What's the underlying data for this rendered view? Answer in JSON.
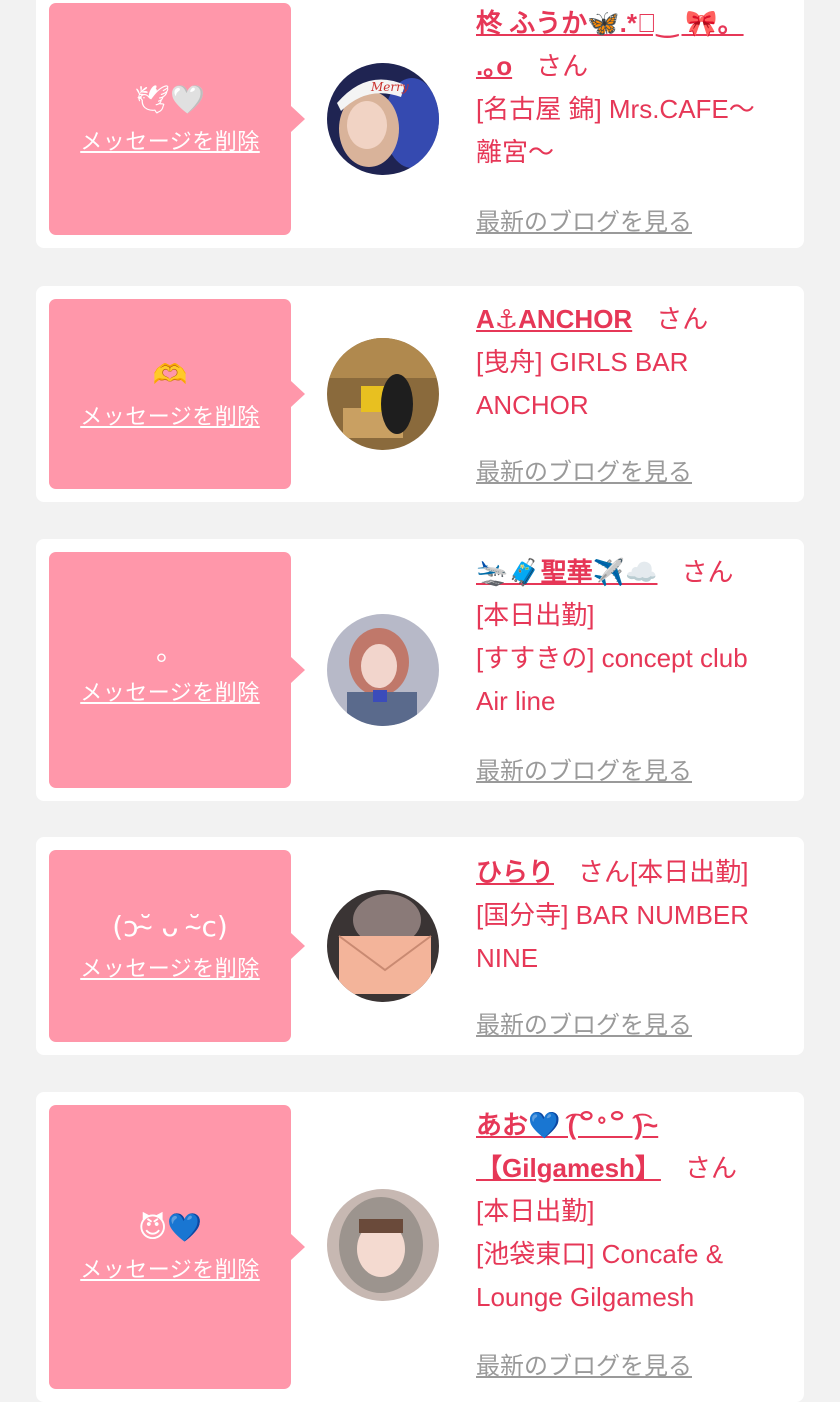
{
  "delete_label": "メッセージを削除",
  "blog_label": "最新のブログを見る",
  "honorific": "さん",
  "colors": {
    "card_bg": "#ffffff",
    "page_bg": "#f2f2f2",
    "bubble_bg": "#ff97aa",
    "accent_text": "#e63757",
    "link_gray": "#9a9a9a"
  },
  "entries": [
    {
      "message": "🕊🤍",
      "name_line1": "柊 ふうか🦋.*ﾟ‿ 🎀。",
      "name_line2": ".｡o",
      "details": [
        "[名古屋 錦] Mrs.CAFE〜",
        "離宮〜"
      ],
      "avatar_icon": "avatar-christmas-photo"
    },
    {
      "message": "🫶",
      "name_line1": "A⚓ANCHOR",
      "details": [
        "[曳舟] GIRLS BAR",
        "ANCHOR"
      ],
      "avatar_icon": "avatar-bar-photo"
    },
    {
      "message": "。",
      "name_line1": "🛬🧳聖華✈️☁️",
      "details": [
        "[本日出勤]",
        "[すすきの] concept club",
        "Air line"
      ],
      "avatar_icon": "avatar-uniform-photo"
    },
    {
      "message": "(ɔ˘̴ ᴗ ˘̴c)",
      "name_line1": "ひらり",
      "name_suffix": "[本日出勤]",
      "details": [
        "[国分寺] BAR NUMBER",
        "NINE"
      ],
      "avatar_icon": "avatar-envelope-photo"
    },
    {
      "message": "😈💙",
      "name_line1": "あお💙 ͡(꒪ᐤ꒪ ͡)~",
      "name_line2": "【Gilgamesh】",
      "details": [
        "[本日出勤]",
        "[池袋東口] Concafe &",
        "Lounge Gilgamesh"
      ],
      "avatar_icon": "avatar-hood-photo"
    }
  ]
}
